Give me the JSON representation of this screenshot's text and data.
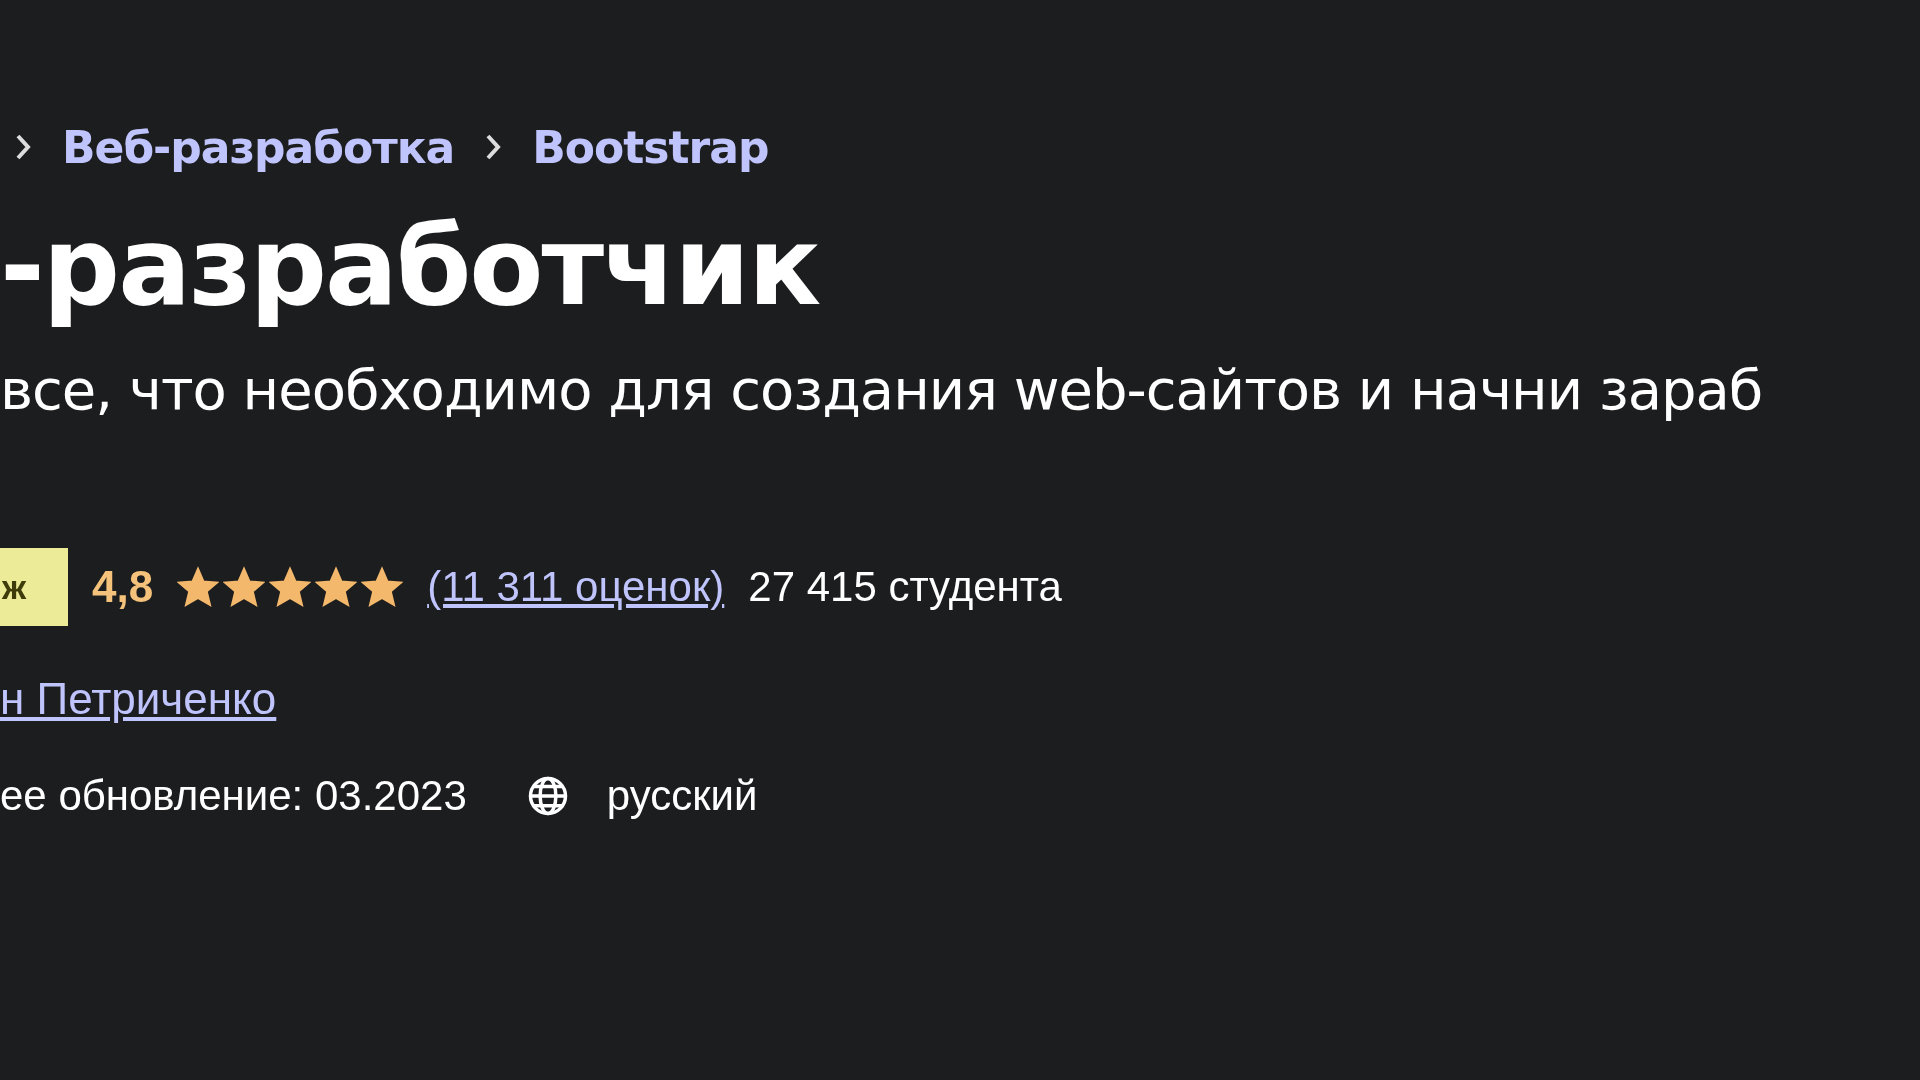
{
  "breadcrumbs": [
    {
      "label": "Веб-разработка"
    },
    {
      "label": "Bootstrap"
    }
  ],
  "title": "-разработчик",
  "subtitle": "все, что необходимо для создания web-сайтов и начни зараб",
  "badge": "ж",
  "rating": {
    "value": "4,8",
    "stars": 5,
    "count": "(11 311 оценок)",
    "students": "27 415 студента"
  },
  "author": "н Петриченко",
  "updated": "ее обновление: 03.2023",
  "language": "русский"
}
